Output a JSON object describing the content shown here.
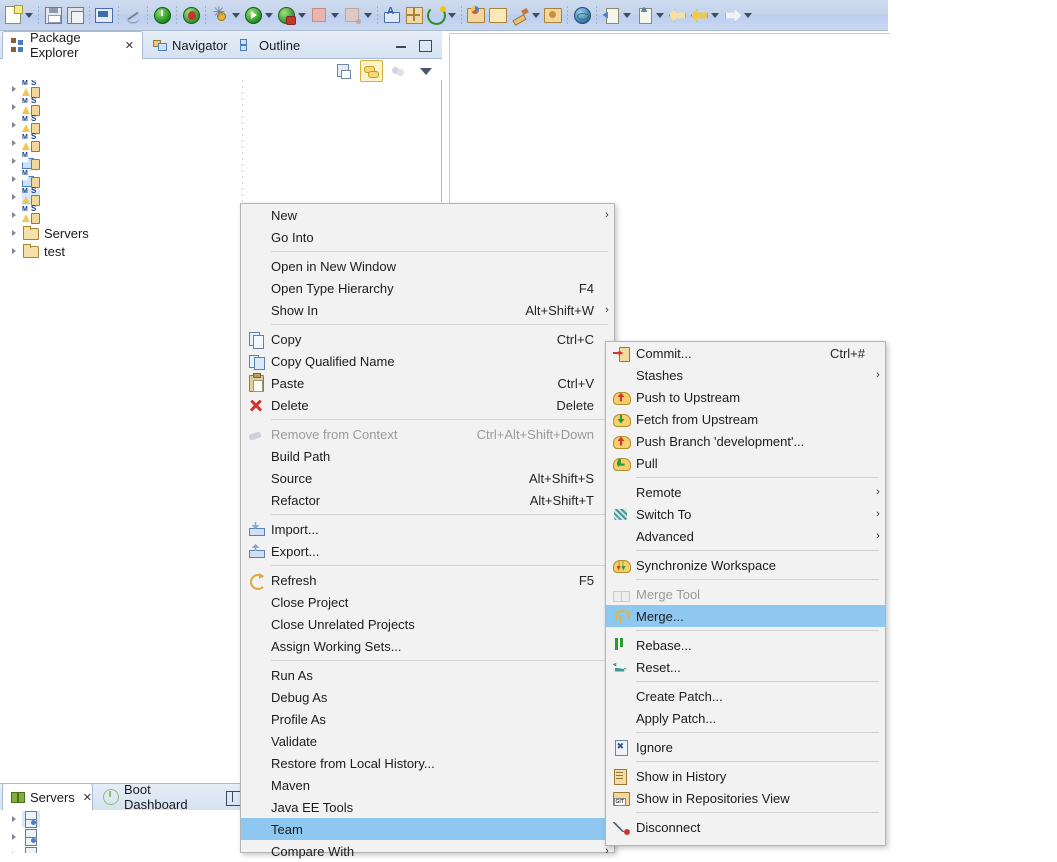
{
  "toolbar": {
    "items": [
      {
        "icon": "new-document-icon",
        "dropdown": true
      },
      {
        "sep": true
      },
      {
        "icon": "save-icon",
        "dropdown": false
      },
      {
        "icon": "save-all-icon",
        "dropdown": false
      },
      {
        "sep": true
      },
      {
        "icon": "console-icon",
        "dropdown": false
      },
      {
        "sep": true
      },
      {
        "icon": "skip-breakpoints-icon",
        "dropdown": false
      },
      {
        "sep": true
      },
      {
        "icon": "terminate-server-icon",
        "dropdown": false
      },
      {
        "sep": true
      },
      {
        "icon": "debug-boot-icon",
        "dropdown": false
      },
      {
        "sep": true
      },
      {
        "icon": "debug-icon",
        "dropdown": true
      },
      {
        "icon": "run-icon",
        "dropdown": true
      },
      {
        "icon": "run-as-server-icon",
        "dropdown": true
      },
      {
        "icon": "stop-icon",
        "dropdown": true
      },
      {
        "icon": "stop-alt-icon",
        "dropdown": true
      },
      {
        "sep": true
      },
      {
        "icon": "new-java-class-icon",
        "dropdown": false
      },
      {
        "icon": "new-package-icon",
        "dropdown": false
      },
      {
        "icon": "refresh-green-icon",
        "dropdown": true
      },
      {
        "sep": true
      },
      {
        "icon": "open-type-icon",
        "dropdown": false
      },
      {
        "icon": "open-folder-icon",
        "dropdown": false
      },
      {
        "icon": "brush-icon",
        "dropdown": true
      },
      {
        "icon": "open-resource-icon",
        "dropdown": false
      },
      {
        "sep": true
      },
      {
        "icon": "globe-icon",
        "dropdown": false
      },
      {
        "sep": true
      },
      {
        "icon": "next-annotation-icon",
        "dropdown": true
      },
      {
        "icon": "prev-annotation-icon",
        "dropdown": true
      },
      {
        "icon": "back-history-icon",
        "dropdown": false
      },
      {
        "icon": "back-icon",
        "dropdown": true
      },
      {
        "icon": "forward-icon",
        "dropdown": true
      }
    ]
  },
  "view_tabs": {
    "items": [
      {
        "label": "Package Explorer",
        "icon": "package-explorer-icon",
        "active": true,
        "close": true
      },
      {
        "label": "Navigator",
        "icon": "navigator-icon",
        "active": false,
        "close": false
      },
      {
        "label": "Outline",
        "icon": "outline-icon",
        "active": false,
        "close": false
      }
    ],
    "minimize_label": "Minimize",
    "maximize_label": "Maximize"
  },
  "explorer_toolbar": {
    "items": [
      {
        "name": "collapse-all-icon",
        "active": false
      },
      {
        "name": "link-with-editor-icon",
        "active": true
      },
      {
        "name": "focus-on-active-task-icon",
        "active": false
      },
      {
        "name": "view-menu-icon",
        "active": false
      }
    ]
  },
  "tree": {
    "items": [
      {
        "label": "",
        "icon": "java-project-icon",
        "expandable": true,
        "selected": false
      },
      {
        "label": "",
        "icon": "java-project-icon",
        "expandable": true,
        "selected": false
      },
      {
        "label": "",
        "icon": "java-project-icon",
        "expandable": true,
        "selected": false
      },
      {
        "label": "",
        "icon": "java-project-icon",
        "expandable": true,
        "selected": false
      },
      {
        "label": "",
        "icon": "maven-project-icon",
        "expandable": true,
        "selected": false
      },
      {
        "label": "",
        "icon": "maven-project-icon",
        "expandable": true,
        "selected": false
      },
      {
        "label": "",
        "icon": "java-project-icon",
        "expandable": true,
        "selected": true
      },
      {
        "label": "",
        "icon": "java-project-icon",
        "expandable": true,
        "selected": false
      },
      {
        "label": "Servers",
        "icon": "folder-icon",
        "expandable": true,
        "selected": false
      },
      {
        "label": "test",
        "icon": "folder-icon",
        "expandable": true,
        "selected": false
      }
    ]
  },
  "bottom_view": {
    "tabs": [
      {
        "label": "Servers",
        "icon": "servers-icon",
        "active": true,
        "close": true
      },
      {
        "label": "Boot Dashboard",
        "icon": "boot-dashboard-icon",
        "active": false,
        "close": false
      }
    ],
    "rows": [
      {
        "icon": "server-icon",
        "label": ""
      },
      {
        "icon": "server-icon",
        "label": ""
      },
      {
        "icon": "server-icon",
        "label": ""
      }
    ]
  },
  "context_menu": {
    "items": [
      {
        "label": "New",
        "accel": "",
        "arrow": true,
        "icon": "",
        "disabled": false,
        "highlight": false
      },
      {
        "label": "Go Into",
        "accel": "",
        "arrow": false,
        "icon": "",
        "disabled": false,
        "highlight": false
      },
      {
        "sep": true
      },
      {
        "label": "Open in New Window",
        "accel": "",
        "arrow": false,
        "icon": "",
        "disabled": false,
        "highlight": false
      },
      {
        "label": "Open Type Hierarchy",
        "accel": "F4",
        "arrow": false,
        "icon": "",
        "disabled": false,
        "highlight": false
      },
      {
        "label": "Show In",
        "accel": "Alt+Shift+W",
        "arrow": true,
        "icon": "",
        "disabled": false,
        "highlight": false
      },
      {
        "sep": true
      },
      {
        "label": "Copy",
        "accel": "Ctrl+C",
        "arrow": false,
        "icon": "copy-icon",
        "disabled": false,
        "highlight": false
      },
      {
        "label": "Copy Qualified Name",
        "accel": "",
        "arrow": false,
        "icon": "copy-qualified-name-icon",
        "disabled": false,
        "highlight": false
      },
      {
        "label": "Paste",
        "accel": "Ctrl+V",
        "arrow": false,
        "icon": "paste-icon",
        "disabled": false,
        "highlight": false
      },
      {
        "label": "Delete",
        "accel": "Delete",
        "arrow": false,
        "icon": "delete-icon",
        "disabled": false,
        "highlight": false
      },
      {
        "sep": true
      },
      {
        "label": "Remove from Context",
        "accel": "Ctrl+Alt+Shift+Down",
        "arrow": false,
        "icon": "remove-from-context-icon",
        "disabled": true,
        "highlight": false
      },
      {
        "label": "Build Path",
        "accel": "",
        "arrow": true,
        "icon": "",
        "disabled": false,
        "highlight": false
      },
      {
        "label": "Source",
        "accel": "Alt+Shift+S",
        "arrow": true,
        "icon": "",
        "disabled": false,
        "highlight": false
      },
      {
        "label": "Refactor",
        "accel": "Alt+Shift+T",
        "arrow": true,
        "icon": "",
        "disabled": false,
        "highlight": false
      },
      {
        "sep": true
      },
      {
        "label": "Import...",
        "accel": "",
        "arrow": false,
        "icon": "import-icon",
        "disabled": false,
        "highlight": false
      },
      {
        "label": "Export...",
        "accel": "",
        "arrow": false,
        "icon": "export-icon",
        "disabled": false,
        "highlight": false
      },
      {
        "sep": true
      },
      {
        "label": "Refresh",
        "accel": "F5",
        "arrow": false,
        "icon": "refresh-icon",
        "disabled": false,
        "highlight": false
      },
      {
        "label": "Close Project",
        "accel": "",
        "arrow": false,
        "icon": "",
        "disabled": false,
        "highlight": false
      },
      {
        "label": "Close Unrelated Projects",
        "accel": "",
        "arrow": false,
        "icon": "",
        "disabled": false,
        "highlight": false
      },
      {
        "label": "Assign Working Sets...",
        "accel": "",
        "arrow": false,
        "icon": "",
        "disabled": false,
        "highlight": false
      },
      {
        "sep": true
      },
      {
        "label": "Run As",
        "accel": "",
        "arrow": true,
        "icon": "",
        "disabled": false,
        "highlight": false
      },
      {
        "label": "Debug As",
        "accel": "",
        "arrow": true,
        "icon": "",
        "disabled": false,
        "highlight": false
      },
      {
        "label": "Profile As",
        "accel": "",
        "arrow": true,
        "icon": "",
        "disabled": false,
        "highlight": false
      },
      {
        "label": "Validate",
        "accel": "",
        "arrow": false,
        "icon": "",
        "disabled": false,
        "highlight": false
      },
      {
        "label": "Restore from Local History...",
        "accel": "",
        "arrow": false,
        "icon": "",
        "disabled": false,
        "highlight": false
      },
      {
        "label": "Maven",
        "accel": "",
        "arrow": true,
        "icon": "",
        "disabled": false,
        "highlight": false
      },
      {
        "label": "Java EE Tools",
        "accel": "",
        "arrow": true,
        "icon": "",
        "disabled": false,
        "highlight": false
      },
      {
        "label": "Team",
        "accel": "",
        "arrow": true,
        "icon": "",
        "disabled": false,
        "highlight": true
      },
      {
        "label": "Compare With",
        "accel": "",
        "arrow": true,
        "icon": "",
        "disabled": false,
        "highlight": false
      }
    ]
  },
  "team_submenu": {
    "items": [
      {
        "label": "Commit...",
        "accel": "Ctrl+#",
        "arrow": false,
        "icon": "git-commit-icon",
        "disabled": false,
        "highlight": false
      },
      {
        "label": "Stashes",
        "accel": "",
        "arrow": true,
        "icon": "",
        "disabled": false,
        "highlight": false
      },
      {
        "label": "Push to Upstream",
        "accel": "",
        "arrow": false,
        "icon": "git-push-icon",
        "disabled": false,
        "highlight": false
      },
      {
        "label": "Fetch from Upstream",
        "accel": "",
        "arrow": false,
        "icon": "git-fetch-icon",
        "disabled": false,
        "highlight": false
      },
      {
        "label": "Push Branch 'development'...",
        "accel": "",
        "arrow": false,
        "icon": "git-push-branch-icon",
        "disabled": false,
        "highlight": false
      },
      {
        "label": "Pull",
        "accel": "",
        "arrow": false,
        "icon": "git-pull-icon",
        "disabled": false,
        "highlight": false
      },
      {
        "sep": true
      },
      {
        "label": "Remote",
        "accel": "",
        "arrow": true,
        "icon": "",
        "disabled": false,
        "highlight": false
      },
      {
        "label": "Switch To",
        "accel": "",
        "arrow": true,
        "icon": "git-switch-to-icon",
        "disabled": false,
        "highlight": false
      },
      {
        "label": "Advanced",
        "accel": "",
        "arrow": true,
        "icon": "",
        "disabled": false,
        "highlight": false
      },
      {
        "sep": true
      },
      {
        "label": "Synchronize Workspace",
        "accel": "",
        "arrow": false,
        "icon": "git-synchronize-icon",
        "disabled": false,
        "highlight": false
      },
      {
        "sep": true
      },
      {
        "label": "Merge Tool",
        "accel": "",
        "arrow": false,
        "icon": "merge-tool-icon",
        "disabled": true,
        "highlight": false
      },
      {
        "label": "Merge...",
        "accel": "",
        "arrow": false,
        "icon": "merge-icon",
        "disabled": false,
        "highlight": true
      },
      {
        "sep": true
      },
      {
        "label": "Rebase...",
        "accel": "",
        "arrow": false,
        "icon": "rebase-icon",
        "disabled": false,
        "highlight": false
      },
      {
        "label": "Reset...",
        "accel": "",
        "arrow": false,
        "icon": "reset-icon",
        "disabled": false,
        "highlight": false
      },
      {
        "sep": true
      },
      {
        "label": "Create Patch...",
        "accel": "",
        "arrow": false,
        "icon": "",
        "disabled": false,
        "highlight": false
      },
      {
        "label": "Apply Patch...",
        "accel": "",
        "arrow": false,
        "icon": "",
        "disabled": false,
        "highlight": false
      },
      {
        "sep": true
      },
      {
        "label": "Ignore",
        "accel": "",
        "arrow": false,
        "icon": "ignore-icon",
        "disabled": false,
        "highlight": false
      },
      {
        "sep": true
      },
      {
        "label": "Show in History",
        "accel": "",
        "arrow": false,
        "icon": "show-in-history-icon",
        "disabled": false,
        "highlight": false
      },
      {
        "label": "Show in Repositories View",
        "accel": "",
        "arrow": false,
        "icon": "show-in-repositories-view-icon",
        "disabled": false,
        "highlight": false
      },
      {
        "sep": true
      },
      {
        "label": "Disconnect",
        "accel": "",
        "arrow": false,
        "icon": "disconnect-icon",
        "disabled": false,
        "highlight": false
      }
    ]
  },
  "colors": {
    "menu_highlight": "#8ec7f0",
    "menu_background": "#f2f2f2",
    "toolbar_background": "#c4d3ea",
    "tab_active": "#ffffff",
    "disabled_text": "#9a9a9a"
  }
}
